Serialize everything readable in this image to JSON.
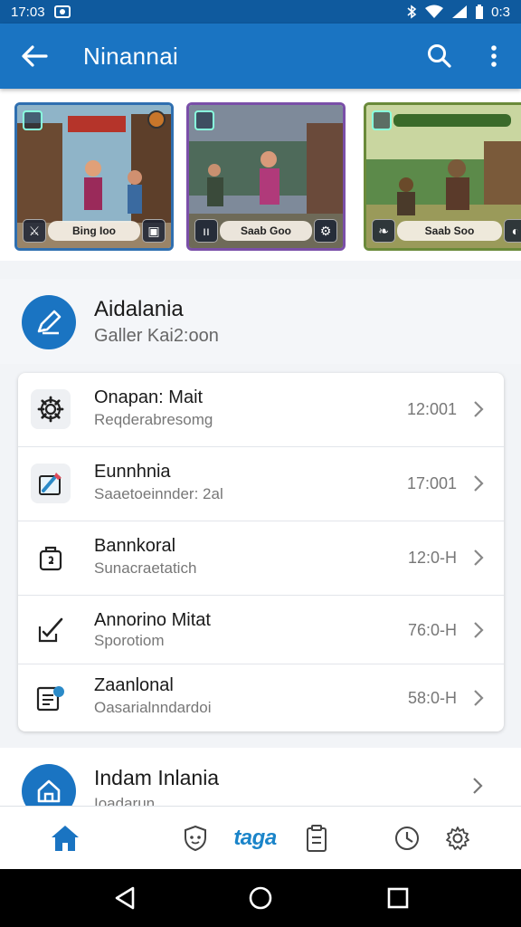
{
  "status_bar": {
    "time": "17:03",
    "battery": "0:3"
  },
  "app_bar": {
    "title": "Ninannai"
  },
  "games": [
    {
      "caption": "Bing Ioo",
      "theme": "#c86b3a"
    },
    {
      "caption": "Saab Goo",
      "theme": "#6a5a9a"
    },
    {
      "caption": "Saab Soo",
      "theme": "#6a8a40"
    }
  ],
  "profile": {
    "name": "Aidalania",
    "subtitle": "Galler Kai2:oon"
  },
  "list": [
    {
      "title": "Onapan: Mait",
      "subtitle": "Reqderabresomg",
      "time": "12:001",
      "icon": "gear-icon"
    },
    {
      "title": "Eunnhnia",
      "subtitle": "Saaetoeinnder: 2al",
      "time": "17:001",
      "icon": "paint-icon"
    },
    {
      "title": "Bannkoral",
      "subtitle": "Sunacraetatich",
      "time": "12:0-H",
      "icon": "bag-icon"
    },
    {
      "title": "Annorino Mitat",
      "subtitle": "Sporotiom",
      "time": "76:0-H",
      "icon": "edit-check-icon"
    },
    {
      "title": "Zaanlonal",
      "subtitle": "Oasarialnndardoi",
      "time": "58:0-H",
      "icon": "document-icon"
    }
  ],
  "bottom_item": {
    "title": "Indam Inlania",
    "subtitle": "Ioadarun"
  },
  "tabbar": {
    "brand": "taga"
  },
  "colors": {
    "primary": "#1a74c2",
    "status": "#0f5a9e",
    "accent": "#1a84c9"
  }
}
